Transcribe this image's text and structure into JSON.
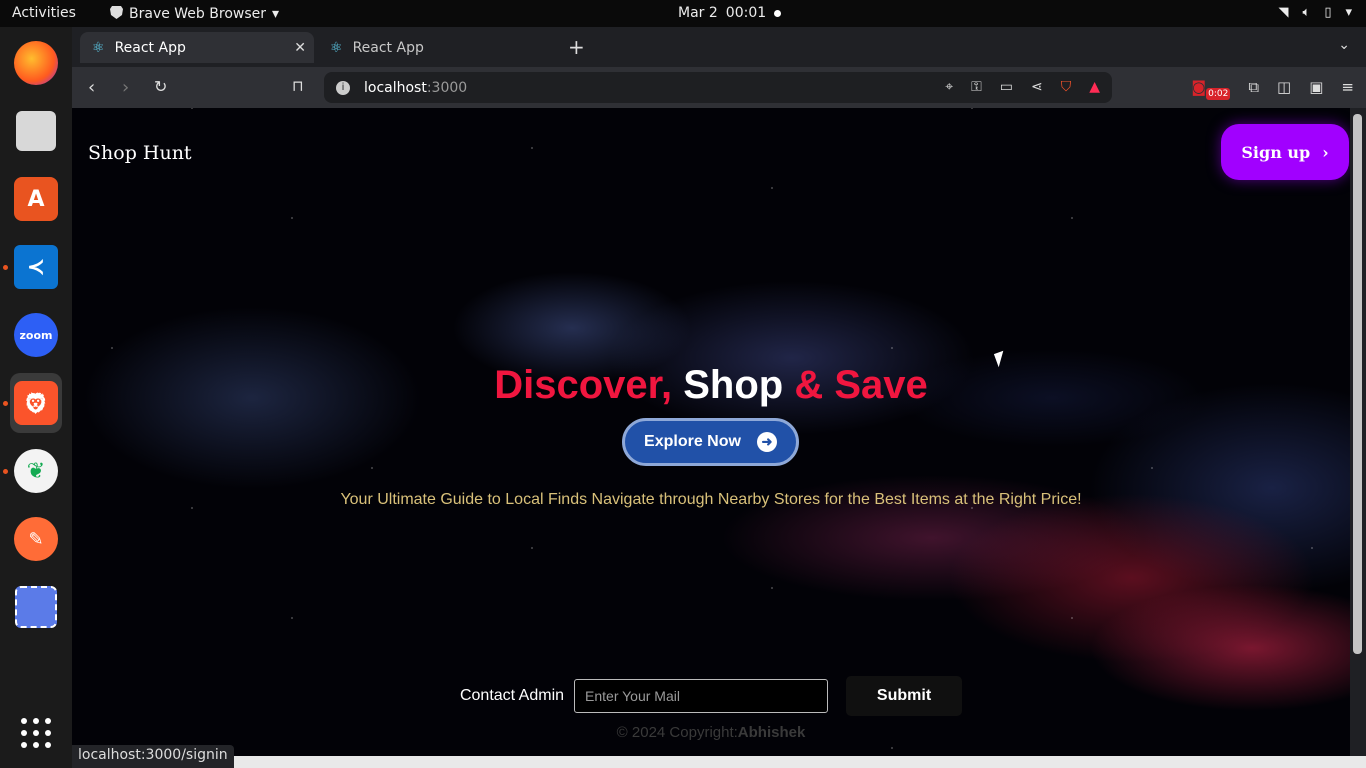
{
  "system": {
    "activities": "Activities",
    "app_menu": "Brave Web Browser",
    "date": "Mar 2",
    "time": "00:01"
  },
  "browser": {
    "tabs": [
      {
        "label": "React App",
        "active": true
      },
      {
        "label": "React App",
        "active": false
      }
    ],
    "url_host": "localhost",
    "url_port": ":3000",
    "recording_time": "0:02",
    "status_url": "localhost:3000/signin"
  },
  "page": {
    "brand": "Shop Hunt",
    "signup_label": "Sign up",
    "hero": {
      "part1": "Discover, ",
      "part2": "Shop",
      "part3": " & Save"
    },
    "explore_label": "Explore Now",
    "tagline": "Your Ultimate Guide to Local Finds Navigate through Nearby Stores for the Best Items at the Right Price!",
    "contact_label": "Contact Admin",
    "mail_placeholder": "Enter Your Mail",
    "submit_label": "Submit",
    "copyright_prefix": "© 2024 Copyright:",
    "copyright_name": "Abhishek"
  },
  "colors": {
    "accent_purple": "#a100ff",
    "hero_red": "#f0163f",
    "explore_blue": "#2151a8"
  }
}
